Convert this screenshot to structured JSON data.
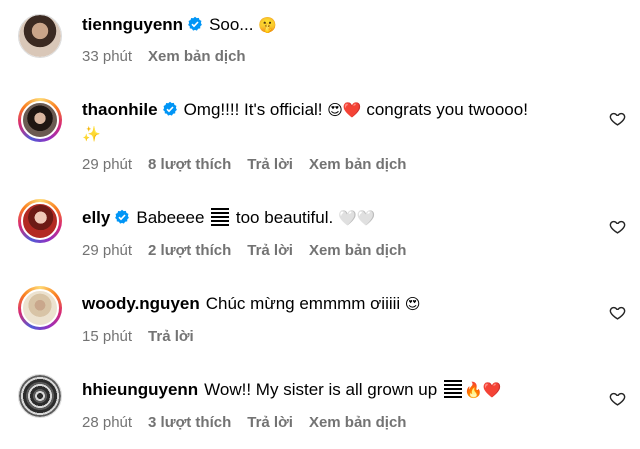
{
  "comments": [
    {
      "username": "tiennguyenn",
      "verified": true,
      "text": "Soo... ",
      "emoji": "🤫",
      "time": "33 phút",
      "likes": "",
      "reply": "",
      "translate": "Xem bản dịch",
      "has_like_button": false
    },
    {
      "username": "thaonhile",
      "verified": true,
      "text": "Omg!!!! It's official! ",
      "emoji": "😍❤️",
      "text2": " congrats you twoooo!",
      "wrap": "✨",
      "time": "29 phút",
      "likes": "8 lượt thích",
      "reply": "Trả lời",
      "translate": "Xem bản dịch",
      "has_like_button": true
    },
    {
      "username": "elly",
      "verified": true,
      "text": "Babeeee ",
      "text2": " too beautiful. ",
      "emoji": "🤍🤍",
      "time": "29 phút",
      "likes": "2 lượt thích",
      "reply": "Trả lời",
      "translate": "Xem bản dịch",
      "has_like_button": true
    },
    {
      "username": "woody.nguyen",
      "verified": false,
      "text": "Chúc mừng emmmm ơiiiii ",
      "emoji": "😍",
      "time": "15 phút",
      "likes": "",
      "reply": "Trả lời",
      "translate": "",
      "has_like_button": true
    },
    {
      "username": "hhieunguyenn",
      "verified": false,
      "text": "Wow!! My sister is all grown up ",
      "emoji": "🔥❤️",
      "time": "28 phút",
      "likes": "3 lượt thích",
      "reply": "Trả lời",
      "translate": "Xem bản dịch",
      "has_like_button": true
    }
  ],
  "colors": {
    "meta_text": "#737373",
    "verified_blue": "#0095f6",
    "heart_outline": "#262626"
  }
}
